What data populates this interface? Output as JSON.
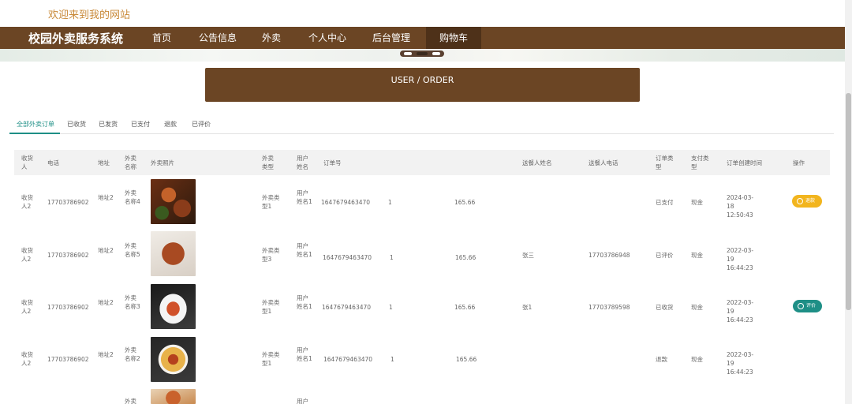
{
  "welcome": "欢迎来到我的网站",
  "nav": {
    "brand": "校园外卖服务系统",
    "items": [
      "首页",
      "公告信息",
      "外卖",
      "个人中心",
      "后台管理",
      "购物车"
    ]
  },
  "page_title": "USER / ORDER",
  "tabs": [
    "全部外卖订单",
    "已收货",
    "已发货",
    "已支付",
    "退款",
    "已评价"
  ],
  "columns": [
    "收货人",
    "电话",
    "地址",
    "外卖名称",
    "外卖照片",
    "外卖类型",
    "用户姓名",
    "订单号",
    "送餐人姓名",
    "送餐人电话",
    "订单类型",
    "支付类型",
    "订单创建时间",
    "操作"
  ],
  "rows": [
    {
      "receiver": "收货人2",
      "phone": "17703786902",
      "address": "地址2",
      "food_name": "外卖名称4",
      "food_type": "外卖类型1",
      "user_name": "用户姓名1",
      "order_no": "1647679463470",
      "qty": "1",
      "price": "165.66",
      "courier_name": "",
      "courier_phone": "",
      "order_status": "已支付",
      "pay_type": "现金",
      "created": "2024-03-18 12:50:43",
      "action": "退款"
    },
    {
      "receiver": "收货人2",
      "phone": "17703786902",
      "address": "地址2",
      "food_name": "外卖名称5",
      "food_type": "外卖类型3",
      "user_name": "用户姓名1",
      "order_no": "1647679463470",
      "qty": "1",
      "price": "165.66",
      "courier_name": "张三",
      "courier_phone": "17703786948",
      "order_status": "已评价",
      "pay_type": "现金",
      "created": "2022-03-19 16:44:23",
      "action": ""
    },
    {
      "receiver": "收货人2",
      "phone": "17703786902",
      "address": "地址2",
      "food_name": "外卖名称3",
      "food_type": "外卖类型1",
      "user_name": "用户姓名1",
      "order_no": "1647679463470",
      "qty": "1",
      "price": "165.66",
      "courier_name": "张1",
      "courier_phone": "17703789598",
      "order_status": "已收货",
      "pay_type": "现金",
      "created": "2022-03-19 16:44:23",
      "action": "评价"
    },
    {
      "receiver": "收货人2",
      "phone": "17703786902",
      "address": "地址2",
      "food_name": "外卖名称2",
      "food_type": "外卖类型1",
      "user_name": "用户姓名1",
      "order_no": "1647679463470",
      "qty": "1",
      "price": "165.66",
      "courier_name": "",
      "courier_phone": "",
      "order_status": "退款",
      "pay_type": "现金",
      "created": "2022-03-19 16:44:23",
      "action": ""
    },
    {
      "food_name": "外卖",
      "user_name": "用户"
    }
  ],
  "colors": {
    "brown": "#6b4524",
    "teal": "#1e8f86",
    "yellow": "#f2b51e"
  }
}
